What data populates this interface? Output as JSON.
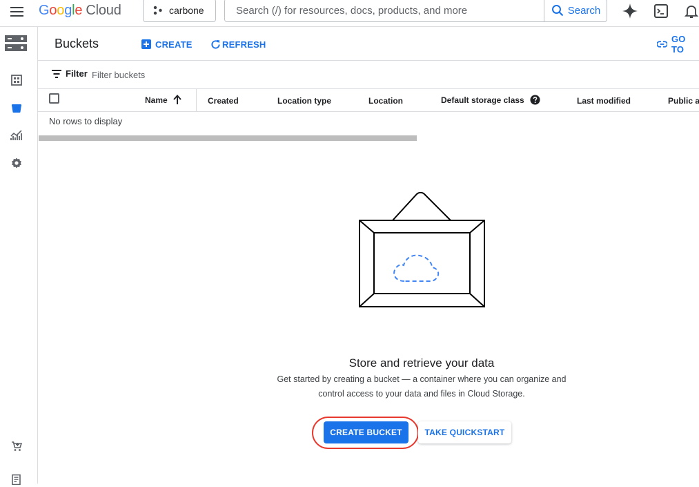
{
  "header": {
    "logo": {
      "letters": [
        "G",
        "o",
        "o",
        "g",
        "l",
        "e"
      ],
      "suffix": "Cloud"
    },
    "project": "carbone",
    "search": {
      "placeholder": "Search (/) for resources, docs, products, and more",
      "button_label": "Search"
    },
    "icons": [
      "menu-icon",
      "gemini-spark-icon",
      "cloud-shell-icon",
      "notifications-bell-icon"
    ]
  },
  "sidenav": {
    "icons": [
      "storage-product-icon",
      "overview-dashboard-icon",
      "buckets-icon",
      "monitoring-icon",
      "settings-icon",
      "marketplace-icon",
      "release-notes-icon"
    ],
    "active": "buckets-icon"
  },
  "page": {
    "title": "Buckets",
    "actions": {
      "create": "CREATE",
      "refresh": "REFRESH",
      "goto": "GO TO"
    }
  },
  "filter": {
    "label": "Filter",
    "placeholder": "Filter buckets"
  },
  "table": {
    "columns": [
      "Name",
      "Created",
      "Location type",
      "Location",
      "Default storage class",
      "Last modified",
      "Public ac"
    ],
    "sort": {
      "column": "Name",
      "direction": "ascending"
    },
    "empty_text": "No rows to display"
  },
  "empty_state": {
    "title": "Store and retrieve your data",
    "description_line1": "Get started by creating a bucket — a container where you can organize and",
    "description_line2": "control access to your data and files in Cloud Storage.",
    "primary_button": "CREATE BUCKET",
    "secondary_button": "TAKE QUICKSTART"
  },
  "colors": {
    "accent": "#1a73e8",
    "highlight_ring": "#e8392e",
    "divider": "#dadce0"
  }
}
